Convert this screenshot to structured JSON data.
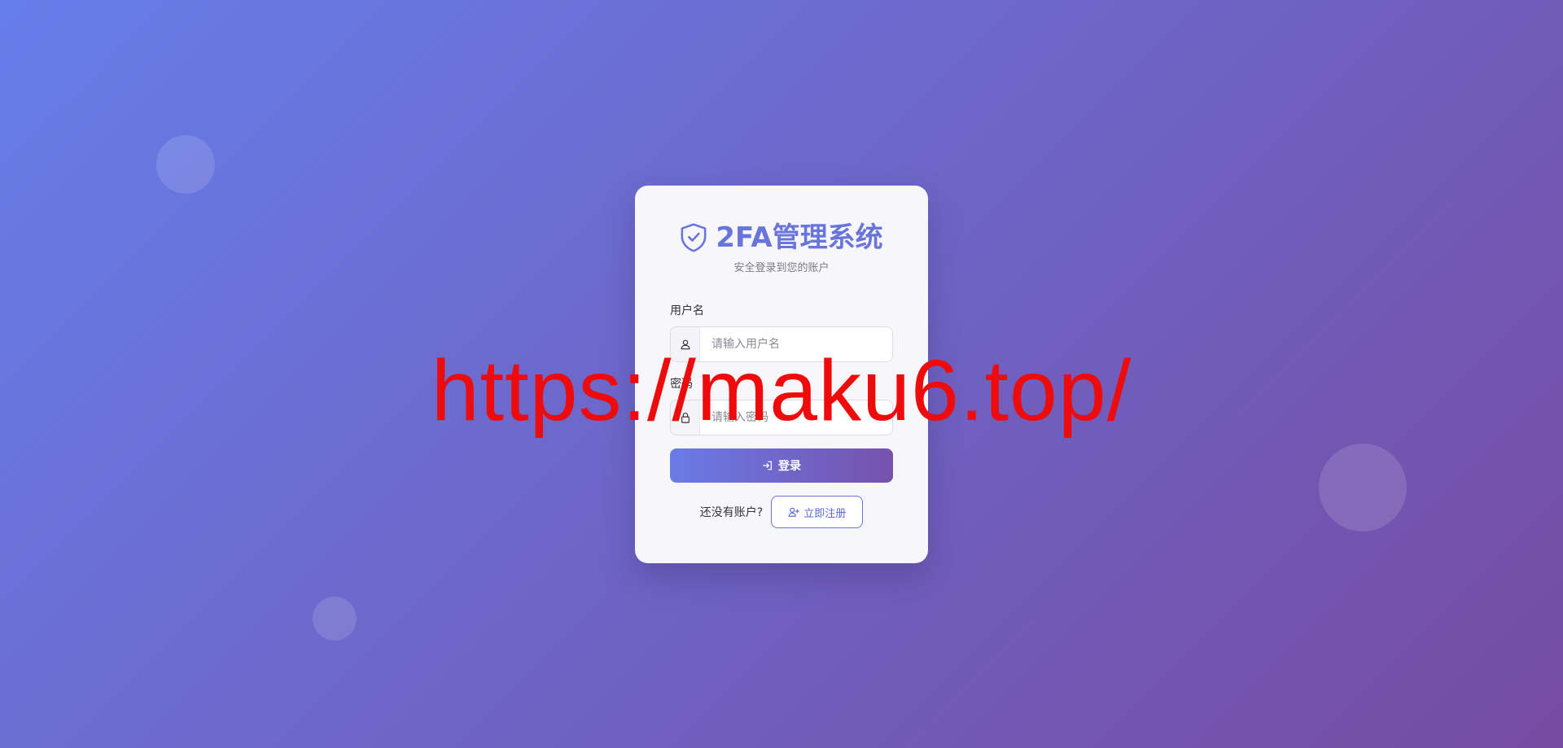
{
  "header": {
    "title": "2FA管理系统",
    "subtitle": "安全登录到您的账户",
    "logo_icon": "shield-check-icon"
  },
  "form": {
    "username_label": "用户名",
    "username_placeholder": "请输入用户名",
    "username_icon": "user-icon",
    "password_label": "密码",
    "password_placeholder": "请输入密码",
    "password_icon": "lock-icon",
    "login_label": "登录",
    "login_icon": "sign-in-icon"
  },
  "register": {
    "prompt": "还没有账户?",
    "button_label": "立即注册",
    "button_icon": "user-plus-icon"
  },
  "overlay": {
    "text": "https://maku6.top/"
  },
  "colors": {
    "bg_start": "#667eea",
    "bg_end": "#764ba2",
    "accent": "#6a75dc",
    "watermark": "#ee0b0b"
  }
}
